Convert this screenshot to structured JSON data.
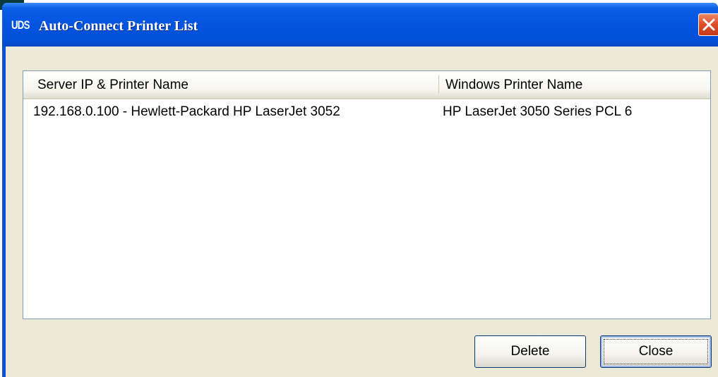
{
  "window": {
    "icon_label": "UDS",
    "title": "Auto-Connect Printer List"
  },
  "list": {
    "columns": [
      "Server IP & Printer Name",
      "Windows Printer Name"
    ],
    "rows": [
      [
        "192.168.0.100 - Hewlett-Packard HP LaserJet 3052",
        "HP LaserJet 3050 Series PCL 6"
      ]
    ]
  },
  "buttons": {
    "delete_label": "Delete",
    "close_label": "Close"
  },
  "colors": {
    "titlebar": "#0454e0",
    "close_button": "#e0502a",
    "dialog_background": "#ece9d8"
  }
}
